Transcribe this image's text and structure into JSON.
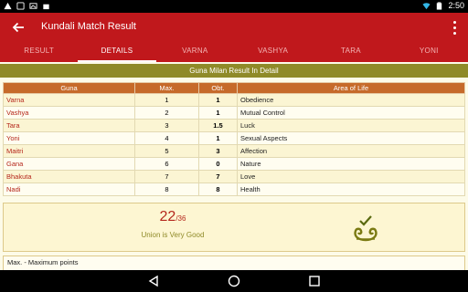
{
  "status_bar": {
    "time": "2:50"
  },
  "app_bar": {
    "title": "Kundali Match Result"
  },
  "tabs": [
    {
      "label": "RESULT",
      "active": false
    },
    {
      "label": "DETAILS",
      "active": true
    },
    {
      "label": "VARNA",
      "active": false
    },
    {
      "label": "VASHYA",
      "active": false
    },
    {
      "label": "TARA",
      "active": false
    },
    {
      "label": "YONI",
      "active": false
    }
  ],
  "section_header": "Guna Milan Result In Detail",
  "table": {
    "headers": [
      "Guna",
      "Max.",
      "Obt.",
      "Area of Life"
    ],
    "rows": [
      {
        "guna": "Varna",
        "max": "1",
        "obt": "1",
        "area": "Obedience"
      },
      {
        "guna": "Vashya",
        "max": "2",
        "obt": "1",
        "area": "Mutual Control"
      },
      {
        "guna": "Tara",
        "max": "3",
        "obt": "1.5",
        "area": "Luck"
      },
      {
        "guna": "Yoni",
        "max": "4",
        "obt": "1",
        "area": "Sexual Aspects"
      },
      {
        "guna": "Maitri",
        "max": "5",
        "obt": "3",
        "area": "Affection"
      },
      {
        "guna": "Gana",
        "max": "6",
        "obt": "0",
        "area": "Nature"
      },
      {
        "guna": "Bhakuta",
        "max": "7",
        "obt": "7",
        "area": "Love"
      },
      {
        "guna": "Nadi",
        "max": "8",
        "obt": "8",
        "area": "Health"
      }
    ]
  },
  "score": {
    "obtained": "22",
    "total": "/36",
    "verdict": "Union is Very Good"
  },
  "note": "Max. - Maximum points",
  "colors": {
    "primary": "#c0181c",
    "olive": "#8f8a28",
    "header_orange": "#c66a2a"
  },
  "icons": [
    "back-arrow-icon",
    "overflow-menu-icon",
    "swans-heart-icon",
    "nav-back-icon",
    "nav-home-icon",
    "nav-recents-icon",
    "wifi-icon",
    "battery-icon"
  ]
}
